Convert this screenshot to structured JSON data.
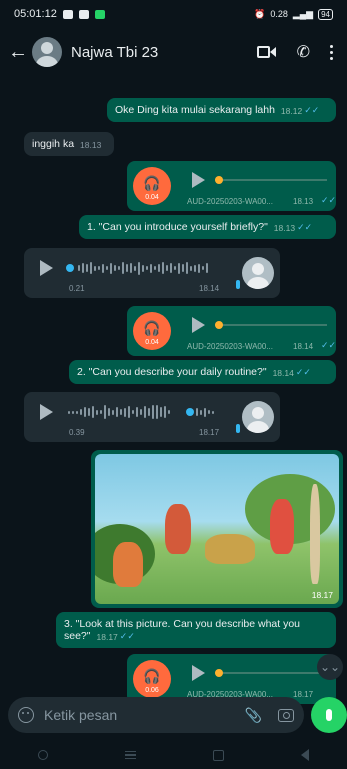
{
  "status_bar": {
    "time": "05:01:12",
    "network": "0.28",
    "battery": "94"
  },
  "header": {
    "contact_name": "Najwa Tbi 23"
  },
  "messages": {
    "m1": {
      "text": "Oke Ding kita mulai sekarang lahh",
      "time": "18.12"
    },
    "m2": {
      "text": "inggih ka",
      "time": "18.13"
    },
    "a1": {
      "duration": "0.04",
      "filename": "AUD-20250203-WA00...",
      "time": "18.13"
    },
    "m3": {
      "text": "1. \"Can you introduce yourself briefly?\"",
      "time": "18.13"
    },
    "v1": {
      "duration": "0.21",
      "time": "18.14"
    },
    "a2": {
      "duration": "0.04",
      "filename": "AUD-20250203-WA00...",
      "time": "18.14"
    },
    "m4": {
      "text": "2. \"Can you describe your daily routine?\"",
      "time": "18.14"
    },
    "v2": {
      "duration": "0.39",
      "time": "18.17"
    },
    "img": {
      "time": "18.17"
    },
    "m5": {
      "text": "3. \"Look at this picture. Can you describe what you see?\"",
      "time": "18.17"
    },
    "a3": {
      "duration": "0.06",
      "filename": "AUD-20250203-WA00...",
      "time": "18.17"
    }
  },
  "composer": {
    "placeholder": "Ketik pesan"
  },
  "colors": {
    "background": "#0b141a",
    "outgoing": "#005c4b",
    "incoming": "#202c33",
    "accent": "#25d366",
    "audio_thumb": "#ff6a3d",
    "tick_read": "#53bdeb"
  },
  "icons": [
    "back-icon",
    "video-call-icon",
    "phone-icon",
    "menu-icon",
    "headphone-icon",
    "play-icon",
    "emoji-icon",
    "attach-icon",
    "camera-icon",
    "mic-icon",
    "scroll-down-icon"
  ]
}
